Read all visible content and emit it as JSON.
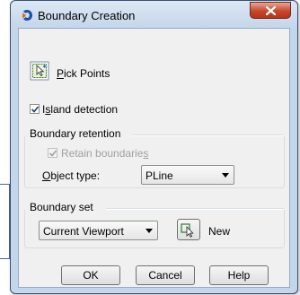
{
  "window": {
    "title": "Boundary Creation",
    "icon": "app-logo-icon",
    "close_icon": "close-icon"
  },
  "pick_points": {
    "label_prefix": "",
    "label_mnemonic": "P",
    "label_rest": "ick Points",
    "icon": "pick-points-icon"
  },
  "island_detection": {
    "label_prefix": "I",
    "label_mnemonic": "s",
    "label_rest": "land detection",
    "checked": true
  },
  "boundary_retention": {
    "heading": "Boundary retention",
    "retain": {
      "label_prefix": "Retain boundarie",
      "label_mnemonic": "s",
      "label_rest": "",
      "checked": true,
      "enabled": false
    },
    "object_type": {
      "label_prefix": "",
      "label_mnemonic": "O",
      "label_rest": "bject type:",
      "value": "PLine"
    }
  },
  "boundary_set": {
    "heading": "Boundary set",
    "selected": "Current Viewport",
    "new_label": "New",
    "new_icon": "select-objects-icon"
  },
  "buttons": {
    "ok": "OK",
    "cancel": "Cancel",
    "help": "Help"
  },
  "colors": {
    "frame": "#c4d6ea",
    "client": "#f0f0f0",
    "close_button": "#c7472c",
    "check": "#1e3e7a"
  }
}
